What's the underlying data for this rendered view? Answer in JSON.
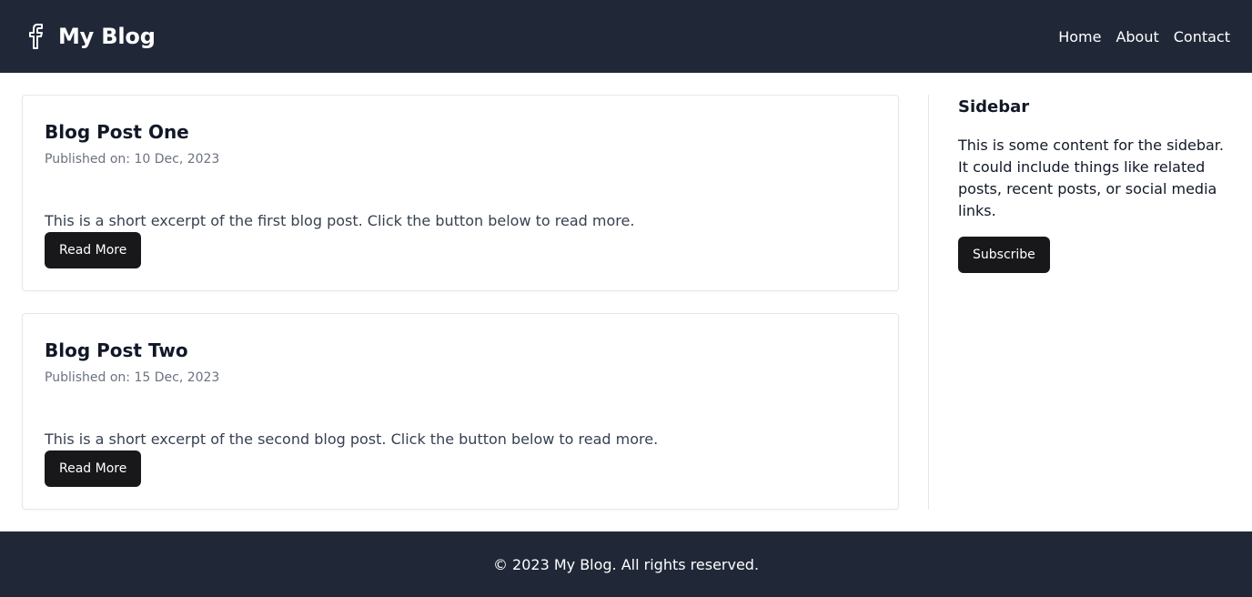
{
  "header": {
    "logo_icon": "facebook-icon",
    "title": "My Blog",
    "nav": [
      {
        "label": "Home"
      },
      {
        "label": "About"
      },
      {
        "label": "Contact"
      }
    ]
  },
  "posts": [
    {
      "title": "Blog Post One",
      "date": "Published on: 10 Dec, 2023",
      "excerpt": "This is a short excerpt of the first blog post. Click the button below to read more.",
      "button": "Read More"
    },
    {
      "title": "Blog Post Two",
      "date": "Published on: 15 Dec, 2023",
      "excerpt": "This is a short excerpt of the second blog post. Click the button below to read more.",
      "button": "Read More"
    }
  ],
  "sidebar": {
    "title": "Sidebar",
    "text": "This is some content for the sidebar. It could include things like related posts, recent posts, or social media links.",
    "button": "Subscribe"
  },
  "footer": {
    "text": "© 2023 My Blog. All rights reserved."
  },
  "colors": {
    "header_bg": "#202838",
    "button_bg": "#18181b",
    "muted_text": "#6b7280",
    "border": "#e5e7eb"
  }
}
